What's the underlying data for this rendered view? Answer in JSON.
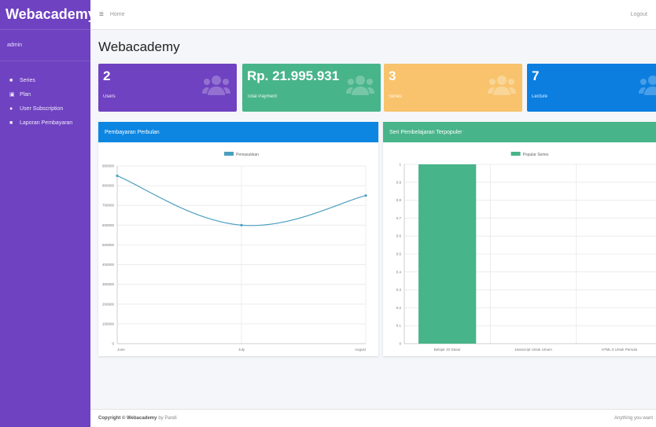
{
  "sidebar": {
    "brand": "Webacademy.",
    "user": "admin",
    "items": [
      {
        "label": "Series",
        "icon": "square-icon"
      },
      {
        "label": "Plan",
        "icon": "card-icon"
      },
      {
        "label": "User Subscription",
        "icon": "users-icon"
      },
      {
        "label": "Laporan Pembayaran",
        "icon": "square-icon"
      }
    ]
  },
  "topbar": {
    "menu_icon": "≡",
    "home": "Home",
    "logout": "Logout"
  },
  "page": {
    "title": "Webacademy"
  },
  "stats": [
    {
      "value": "2",
      "label": "Users",
      "color": "#6f42c1"
    },
    {
      "value": "Rp. 21.995.931",
      "label": "Total Payment",
      "color": "#48b48a"
    },
    {
      "value": "3",
      "label": "Series",
      "color": "#f8c36c"
    },
    {
      "value": "7",
      "label": "Lecture",
      "color": "#0b7ee0"
    }
  ],
  "cards": {
    "left_title": "Pembayaran Perbulan",
    "right_title": "Seri Pembelajaran Terpopuler"
  },
  "chart_data": [
    {
      "type": "line",
      "series": [
        {
          "name": "Pemasukkan",
          "values": [
            850000,
            600000,
            750000
          ]
        }
      ],
      "categories": [
        "June",
        "July",
        "August"
      ],
      "yticks": [
        0,
        100000,
        200000,
        300000,
        400000,
        500000,
        600000,
        700000,
        800000,
        900000
      ],
      "ylim": [
        0,
        900000
      ],
      "color": "#4a9fbf"
    },
    {
      "type": "bar",
      "series": [
        {
          "name": "Popular Series",
          "values": [
            1,
            0,
            0
          ]
        }
      ],
      "categories": [
        "Belajar JS Dasar",
        "Javascript Untuk Umum",
        "HTML 5 Untuk Pemula"
      ],
      "yticks": [
        0,
        0.1,
        0.2,
        0.3,
        0.4,
        0.5,
        0.6,
        0.7,
        0.8,
        0.9,
        1.0
      ],
      "ylim": [
        0,
        1
      ],
      "color": "#48b48a"
    }
  ],
  "footer": {
    "copyright": "Copyright © Webacademy",
    "author": "by Pandi",
    "right": "Anything you want"
  }
}
